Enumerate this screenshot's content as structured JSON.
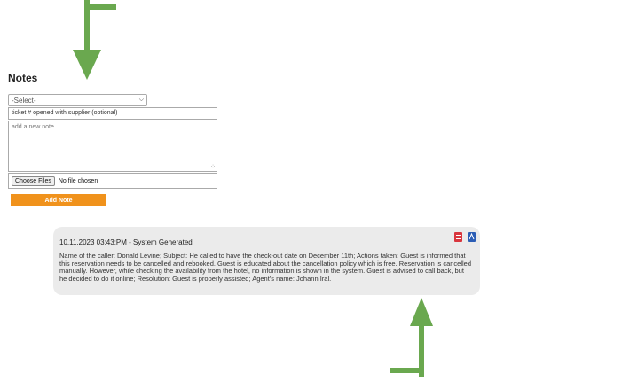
{
  "notes": {
    "title": "Notes",
    "select_value": "-Select-",
    "ticket_value": "ticket # opened with supplier (optional)",
    "note_placeholder": "add a new note...",
    "choose_files_label": "Choose Files",
    "no_file_label": "No file chosen",
    "add_note_label": "Add Note",
    "accent_color": "#f0921c"
  },
  "note_card": {
    "header": "10.11.2023 03:43:PM - System Generated",
    "body": "Name of the caller: Donald Levine; Subject: He called to have the check-out date on December 11th; Actions taken: Guest is informed that this reservation needs to be cancelled and rebooked. Guest is educated about the cancellation policy which is free. Reservation is cancelled manually. However, while checking the availability from the hotel, no information is shown in the system. Guest is advised to call back, but he decided to do it online; Resolution: Guest is properly assisted; Agent's name: Johann Iral.",
    "icons": [
      "pdf-icon",
      "document-icon"
    ]
  },
  "annotations": {
    "arrow_color": "#6aa84f"
  }
}
